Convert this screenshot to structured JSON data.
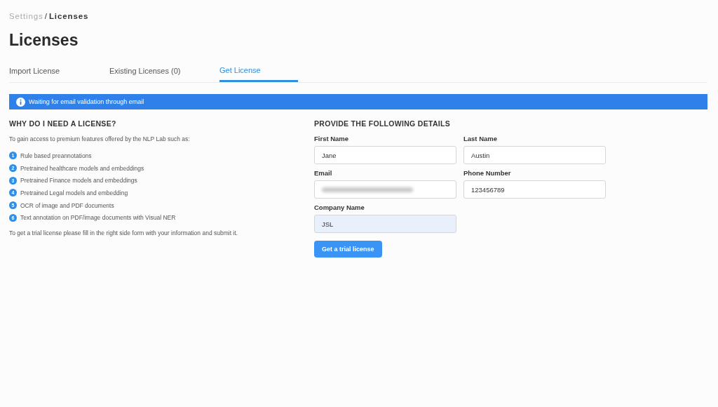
{
  "breadcrumb": [
    {
      "label": "Settings",
      "current": false
    },
    {
      "label": "Licenses",
      "current": true
    }
  ],
  "breadcrumb_separator": "/",
  "title": "Licenses",
  "tabs": [
    {
      "label": "Import License",
      "selected": false
    },
    {
      "label": "Existing Licenses  (0)",
      "selected": false
    },
    {
      "label": "Get License",
      "selected": true
    }
  ],
  "banner": {
    "text": "Waiting for email validation through email"
  },
  "info": {
    "heading": "WHY DO I NEED A LICENSE?",
    "intro": "To gain access to premium features offered by the NLP Lab such as:",
    "features": [
      {
        "number": "1",
        "text": "Rule based preannotations"
      },
      {
        "number": "2",
        "text": "Pretrained healthcare models and embeddings"
      },
      {
        "number": "3",
        "text": "Pretrained Finance models and embeddings"
      },
      {
        "number": "4",
        "text": "Pretrained Legal models and embedding"
      },
      {
        "number": "5",
        "text": "OCR of image and PDF documents"
      },
      {
        "number": "6",
        "text": "Text annotation on PDF/image documents with Visual NER"
      }
    ],
    "outro": "To get a trial license please fill in the right side form with your information and submit it."
  },
  "form": {
    "heading": "PROVIDE THE FOLLOWING DETAILS",
    "fields": [
      {
        "label": "First Name",
        "value": "Jane",
        "kind": "plain"
      },
      {
        "label": "Last Name",
        "value": "Austin",
        "kind": "plain"
      },
      {
        "label": "Email",
        "kind": "blurred"
      },
      {
        "label": "Phone Number",
        "value": "123456789",
        "kind": "plain"
      },
      {
        "label": "Company Name",
        "value": "JSL",
        "kind": "autofilled"
      }
    ],
    "submit": "Get a trial license"
  }
}
